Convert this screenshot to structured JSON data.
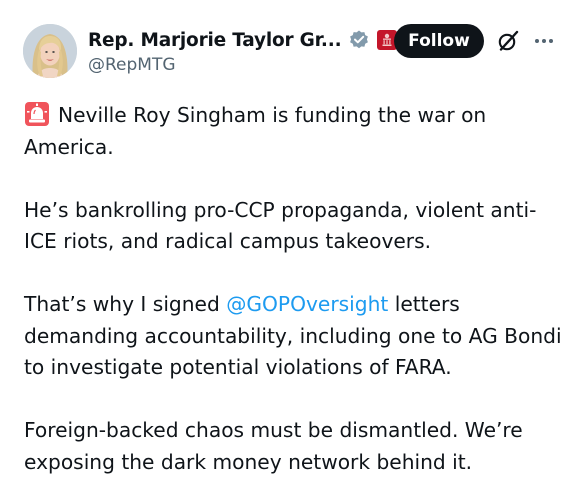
{
  "author": {
    "display_name": "Rep. Marjorie Taylor Gr...",
    "handle": "@RepMTG",
    "verified_icon": "verified-badge-gray",
    "affiliate_icon": "us-house-seal"
  },
  "header": {
    "follow_label": "Follow",
    "grok_icon": "grok-icon",
    "more_icon": "more-icon"
  },
  "post": {
    "p1_text": "Neville Roy Singham is funding the war on America.",
    "p1_icon": "siren-icon",
    "p2_text": "He’s bankrolling pro-CCP propaganda, violent anti-ICE riots, and radical campus takeovers.",
    "p3_before": "That’s why I signed ",
    "p3_mention": "@GOPOversight",
    "p3_after": " letters demanding accountability, including one to AG Bondi to investigate potential violations of FARA.",
    "p4_text": "Foreign-backed chaos must be dismantled. We’re exposing the dark money network behind it."
  },
  "colors": {
    "text": "#0f1419",
    "secondary": "#536471",
    "link": "#1d9bf0",
    "follow_bg": "#0f1419"
  }
}
